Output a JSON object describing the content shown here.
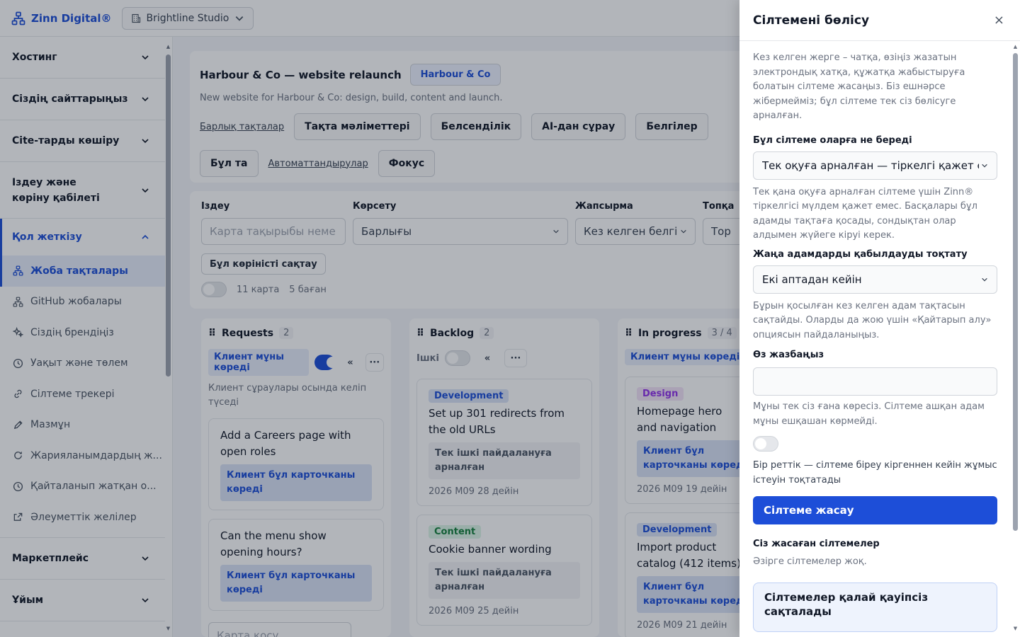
{
  "topbar": {
    "brand": "Zinn Digital®",
    "workspace": "Brightline Studio"
  },
  "sidebar": {
    "sections_top": [
      "Хостинг",
      "Сіздің сайттарыңыз",
      "Cite-тарды көшіру"
    ],
    "search_section": "Іздеу және көріну қабілеті",
    "open_section": "Қол жеткізу",
    "items": [
      "Жоба тақталары",
      "GitHub жобалары",
      "Сіздің брендіңіз",
      "Уақыт және төлем",
      "Сілтеме трекері",
      "Мазмұн",
      "Жарияланымдардың ж...",
      "Қайталанып жатқан о...",
      "Әлеуметтік желілер"
    ],
    "sections_bottom": [
      "Маркетплейс",
      "Ұйым"
    ]
  },
  "board": {
    "title": "Harbour & Co — website relaunch",
    "client_pill": "Harbour & Co",
    "description": "New website for Harbour & Co: design, build, content and launch.",
    "link_all": "Барлық тақталар",
    "tabs": [
      "Тақта мәліметтері",
      "Белсенділік",
      "AI-дан сұрау",
      "Белгілер",
      "Бұл та"
    ],
    "link_automations": "Автоматтандырулар",
    "tab_focus": "Фокус"
  },
  "filters": {
    "search_label": "Іздеу",
    "search_placeholder": "Карта тақырыбы неме",
    "show_label": "Көрсету",
    "show_value": "Барлығы",
    "label_label": "Жапсырма",
    "label_value": "Кез келген белгі",
    "group_label": "Топқа",
    "group_value": "Тор",
    "save_view": "Бұл көріністі сақтау",
    "cards_count": "11 карта",
    "columns_count": "5 баған"
  },
  "columns": [
    {
      "title": "Requests",
      "count": "2",
      "visibility": "Клиент мұны көреді",
      "collapse": "«",
      "more": "···",
      "hint": "Клиент сұраулары осында келіп түседі",
      "cards": [
        {
          "title": "Add a Careers page with open roles",
          "visible": "Клиент бұл карточканы көреді"
        },
        {
          "title": "Can the menu show opening hours?",
          "visible": "Клиент бұл карточканы көреді"
        }
      ],
      "add_card": "Карта қосу"
    },
    {
      "title": "Backlog",
      "count": "2",
      "visibility": "Ішкі",
      "collapse": "«",
      "more": "···",
      "cards": [
        {
          "tag": "Development",
          "title": "Set up 301 redirects from the old URLs",
          "internal": "Тек ішкі пайдалануға арналған",
          "date": "2026 M09 28 дейін"
        },
        {
          "tag": "Content",
          "title": "Cookie banner wording",
          "internal": "Тек ішкі пайдалануға арналған",
          "date": "2026 M09 25 дейін"
        }
      ]
    },
    {
      "title": "In progress",
      "count": "3 / 4",
      "visibility": "Клиент мұны көреді",
      "cards": [
        {
          "tag": "Design",
          "title": "Homepage hero and navigation",
          "visible": "Клиент бұл карточканы көреді",
          "date": "2026 M09 19 дейін"
        },
        {
          "tag": "Development",
          "title": "Import product catalog (412 items)",
          "visible": "Клиент бұл карточканы көреді",
          "date": "2026 M09 21 дейін"
        }
      ]
    }
  ],
  "panel": {
    "title": "Сілтемені бөлісу",
    "close": "×",
    "intro": "Кез келген жерге – чатқа, өзіңіз жазатын электрондық хатқа, құжатқа жабыстыруға болатын сілтеме жасаңыз. Біз ешнәрсе жібермейміз; бұл сілтеме тек сіз бөлісуге арналған.",
    "grant_label": "Бұл сілтеме оларға не береді",
    "grant_value": "Тек оқуға арналған — тіркелгі қажет ем",
    "grant_help": "Тек қана оқуға арналған сілтеме үшін Zinn® тіркелгісі мүлдем қажет емес. Басқалары бұл адамды тақтаға қосады, сондықтан олар алдымен жүйеге кіруі керек.",
    "stop_label": "Жаңа адамдарды қабылдауды тоқтату",
    "stop_value": "Екі аптадан кейін",
    "stop_help": "Бұрын қосылған кез келген адам тақтасын сақтайды. Оларды да жою үшін «Қайтарып алу» опциясын пайдаланыңыз.",
    "note_label": "Өз жазбаңыз",
    "note_value": "",
    "note_help": "Мұны тек сіз ғана көресіз. Сілтеме ашқан адам мұны ешқашан көрмейді.",
    "oneuse_help": "Бір реттік — сілтеме біреу кіргеннен кейін жұмыс істеуін тоқтатады",
    "create_button": "Сілтеме жасау",
    "links_label": "Сіз жасаған сілтемелер",
    "links_empty": "Әзірге сілтемелер жоқ.",
    "safety_title": "Сілтемелер қалай қауіпсіз сақталады"
  },
  "colors": {
    "accent": "#1d4ed8",
    "dev_tag_bg": "#dbe4f7",
    "content_tag_bg": "#dcf5e6",
    "content_tag_fg": "#15803d",
    "design_tag_bg": "#f3e3f8",
    "design_tag_fg": "#9333ea"
  }
}
